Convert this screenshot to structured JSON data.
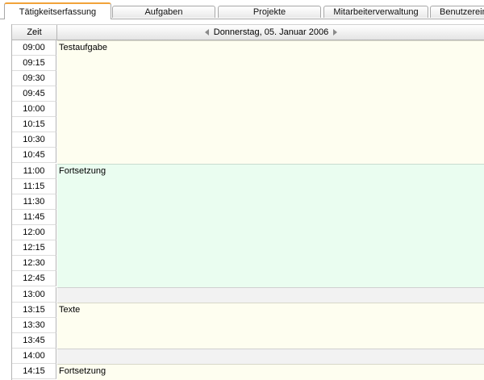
{
  "tabs": [
    {
      "label": "Tätigkeitserfassung",
      "active": true
    },
    {
      "label": "Aufgaben",
      "active": false
    },
    {
      "label": "Projekte",
      "active": false
    },
    {
      "label": "Mitarbeiterverwaltung",
      "active": false
    },
    {
      "label": "Benutzerein",
      "active": false
    }
  ],
  "calendar": {
    "time_header": "Zeit",
    "date": "Donnerstag, 05. Januar 2006",
    "times": [
      "09:00",
      "09:15",
      "09:30",
      "09:45",
      "10:00",
      "10:15",
      "10:30",
      "10:45",
      "11:00",
      "11:15",
      "11:30",
      "11:45",
      "12:00",
      "12:15",
      "12:30",
      "12:45",
      "13:00",
      "13:15",
      "13:30",
      "13:45",
      "14:00",
      "14:15"
    ],
    "entries": [
      {
        "title": "Testaufgabe",
        "color": "#fefef0"
      },
      {
        "title": "Fortsetzung",
        "color": "#eafdf0"
      },
      {
        "title": "Texte",
        "color": "#fefef0"
      },
      {
        "title": "Fortsetzung",
        "color": "#fefef0"
      }
    ]
  }
}
